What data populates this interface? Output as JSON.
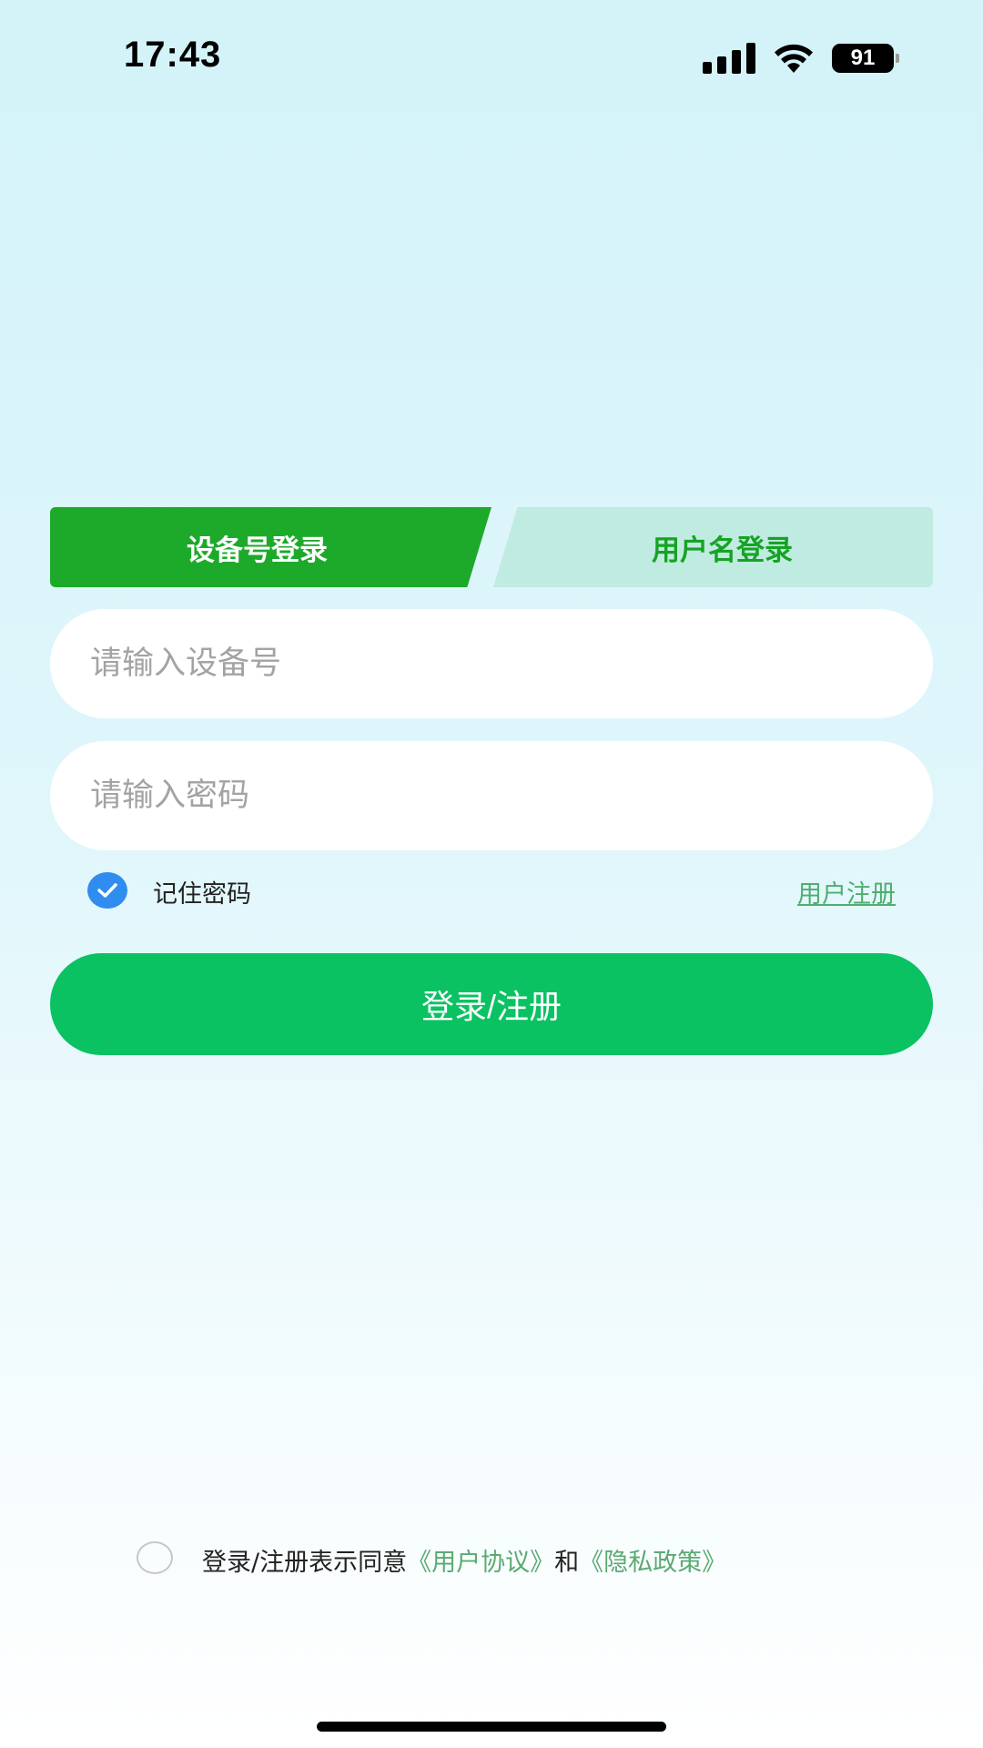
{
  "status_bar": {
    "time": "17:43",
    "battery": "91",
    "icons": [
      "signal-icon",
      "wifi-icon",
      "battery-icon"
    ]
  },
  "tabs": {
    "active_label": "设备号登录",
    "inactive_label": "用户名登录"
  },
  "form": {
    "device_placeholder": "请输入设备号",
    "password_placeholder": "请输入密码",
    "remember_label": "记住密码",
    "remember_checked": true,
    "register_link": "用户注册",
    "login_button": "登录/注册"
  },
  "agreement": {
    "checked": false,
    "prefix": "登录/注册表示同意",
    "user_agreement": "《用户协议》",
    "conjunction": "和",
    "privacy_policy": "《隐私政策》"
  },
  "colors": {
    "active_tab": "#1daa2a",
    "inactive_tab": "#c0ebe0",
    "button": "#0ac262",
    "checkbox": "#2f8df0",
    "link": "#5aaa72"
  }
}
